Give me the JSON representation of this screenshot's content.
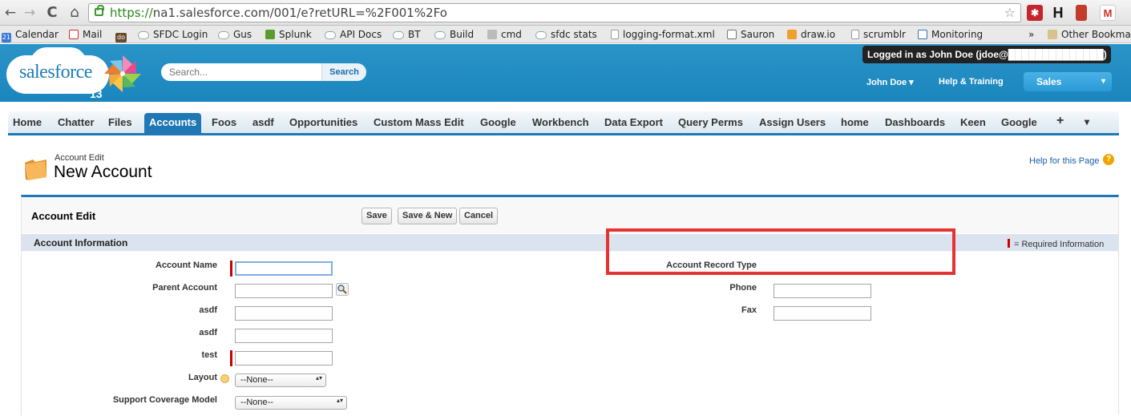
{
  "browser": {
    "url_scheme": "https://",
    "url_rest": "na1.salesforce.com/001/e?retURL=%2F001%2Fo",
    "ext_h_label": "H",
    "ext_mail_label": "M",
    "back_glyph": "←",
    "forward_glyph": "→",
    "reload_glyph": "C",
    "home_glyph": "⌂",
    "star_glyph": "☆"
  },
  "bookmarks": {
    "items": [
      {
        "label": "Calendar",
        "icon": "calendar-icon"
      },
      {
        "label": "Mail",
        "icon": "gmail-icon"
      },
      {
        "label": "SFDC Login",
        "icon": "cloud-icon"
      },
      {
        "label": "Gus",
        "icon": "cloud-icon"
      },
      {
        "label": "Splunk",
        "icon": "splunk-icon"
      },
      {
        "label": "API Docs",
        "icon": "cloud-icon"
      },
      {
        "label": "BT",
        "icon": "cloud-icon"
      },
      {
        "label": "Build",
        "icon": "cloud-icon"
      },
      {
        "label": "cmd",
        "icon": "cmd-icon"
      },
      {
        "label": "sfdc stats",
        "icon": "cloud-icon"
      },
      {
        "label": "logging-format.xml",
        "icon": "document-icon"
      },
      {
        "label": "Sauron",
        "icon": "chart-icon"
      },
      {
        "label": "draw.io",
        "icon": "drawio-icon"
      },
      {
        "label": "scrumblr",
        "icon": "document-icon"
      },
      {
        "label": "Monitoring",
        "icon": "monitor-icon"
      }
    ],
    "calendar_day": "21",
    "do_label": "do",
    "overflow": "»",
    "other": "Other Bookmarks"
  },
  "header": {
    "logo_text": "salesforce",
    "logo_number": "13",
    "search_placeholder": "Search...",
    "search_button": "Search",
    "logged_in": "Logged in as John Doe (jdoe@██████████████)",
    "user_menu": "John Doe ▾",
    "help_training": "Help & Training",
    "app_menu": "Sales",
    "app_menu_arrow": "▾"
  },
  "tabs": [
    {
      "label": "Home",
      "active": false
    },
    {
      "label": "Chatter",
      "active": false
    },
    {
      "label": "Files",
      "active": false
    },
    {
      "label": "Accounts",
      "active": true
    },
    {
      "label": "Foos",
      "active": false
    },
    {
      "label": "asdf",
      "active": false
    },
    {
      "label": "Opportunities",
      "active": false
    },
    {
      "label": "Custom Mass Edit",
      "active": false
    },
    {
      "label": "Google",
      "active": false
    },
    {
      "label": "Workbench",
      "active": false
    },
    {
      "label": "Data Export",
      "active": false
    },
    {
      "label": "Query Perms",
      "active": false
    },
    {
      "label": "Assign Users",
      "active": false
    },
    {
      "label": "home",
      "active": false
    },
    {
      "label": "Dashboards",
      "active": false
    },
    {
      "label": "Keen",
      "active": false
    },
    {
      "label": "Google",
      "active": false
    },
    {
      "label": "+",
      "active": false
    },
    {
      "label": "▾",
      "active": false
    }
  ],
  "page": {
    "breadcrumb": "Account Edit",
    "title": "New Account",
    "help_link": "Help for this Page",
    "help_icon": "?"
  },
  "panel": {
    "title": "Account Edit",
    "buttons": {
      "save": "Save",
      "save_new": "Save & New",
      "cancel": "Cancel"
    },
    "section_title": "Account Information",
    "required_legend": "= Required Information"
  },
  "form": {
    "left": [
      {
        "label": "Account Name",
        "value": "",
        "required": true
      },
      {
        "label": "Parent Account",
        "value": "",
        "required": false
      },
      {
        "label": "asdf",
        "value": "",
        "required": false
      },
      {
        "label": "asdf",
        "value": "",
        "required": false
      },
      {
        "label": "test",
        "value": "",
        "required": true
      }
    ],
    "layout_label": "Layout",
    "layout_value": "--None--",
    "support_label": "Support Coverage Model",
    "support_value": "--None--",
    "select_arrows": "▴▾",
    "right": {
      "record_type_label": "Account Record Type",
      "phone_label": "Phone",
      "phone_value": "",
      "fax_label": "Fax",
      "fax_value": ""
    }
  },
  "colors": {
    "header_blue": "#1b86bd",
    "tab_active": "#1f77b4",
    "required_red": "#cc0000",
    "highlight_box": "#e53333"
  }
}
